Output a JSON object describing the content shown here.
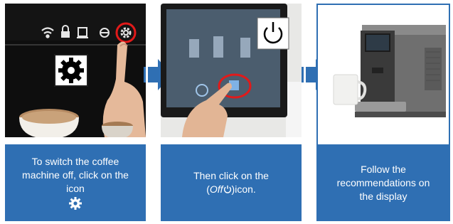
{
  "step1": {
    "caption_text": "To switch the coffee machine off, click on the icon",
    "icons": [
      "wifi-icon",
      "lock-icon",
      "cup-icon",
      "circle-minus-icon",
      "gear-icon"
    ],
    "callout_icon": "gear-icon",
    "highlight_color": "#e11a1a"
  },
  "step2": {
    "caption_prefix": "Then click on the",
    "caption_open": "(",
    "caption_off": "Off",
    "caption_close": ")",
    "caption_suffix": "icon.",
    "callout_icon": "power-icon",
    "highlight_color": "#e11a1a"
  },
  "step3": {
    "caption_text": "Follow the recommendations on the display"
  },
  "colors": {
    "accent": "#2f6fb3",
    "caption_text": "#ffffff"
  }
}
